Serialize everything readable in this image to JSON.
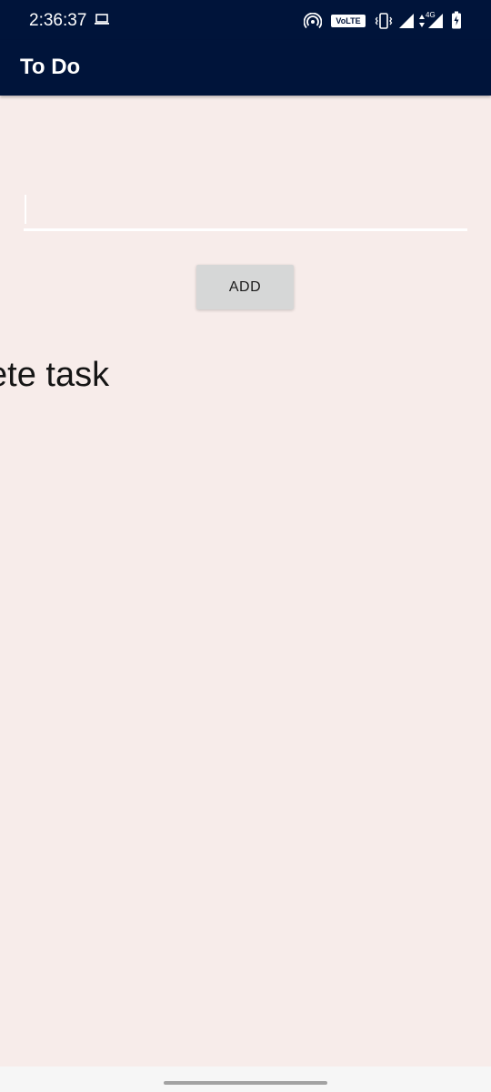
{
  "status_bar": {
    "time": "2:36:37",
    "volte": "VoLTE",
    "network": "4G",
    "icons": [
      "laptop-icon",
      "hotspot-icon",
      "vibrate-icon",
      "signal-icon",
      "data-arrows-icon",
      "battery-icon"
    ]
  },
  "app_bar": {
    "title": "To Do"
  },
  "task_input": {
    "value": "",
    "placeholder": ""
  },
  "add_button": {
    "label": "ADD"
  },
  "tasks": [
    {
      "text": "Delete task"
    }
  ],
  "colors": {
    "app_bar": "#00143a",
    "background": "#f7ecea",
    "button": "#d6d7d7",
    "input_line": "#ffffff"
  }
}
